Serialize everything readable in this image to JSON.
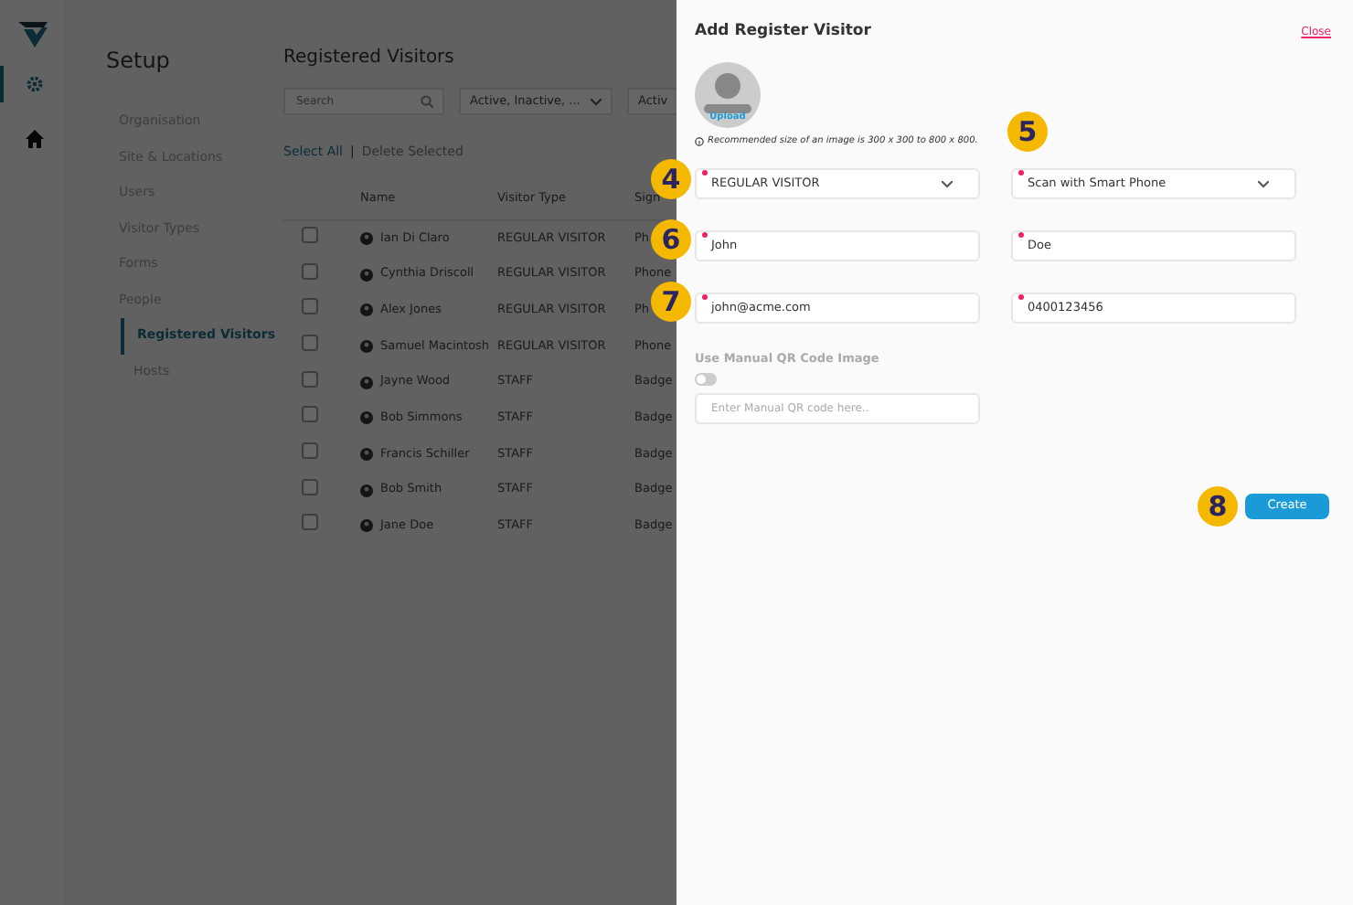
{
  "rail": {
    "items": [
      {
        "kind": "gear",
        "selected": true
      },
      {
        "kind": "home",
        "selected": false
      }
    ]
  },
  "setup": {
    "title": "Setup",
    "nav": [
      {
        "label": "Organisation",
        "selected": false
      },
      {
        "label": "Site & Locations",
        "selected": false
      },
      {
        "label": "Users",
        "selected": false
      },
      {
        "label": "Visitor Types",
        "selected": false
      },
      {
        "label": "Forms",
        "selected": false
      },
      {
        "label": "People",
        "selected": false,
        "children": [
          {
            "label": "Registered Visitors",
            "selected": true
          },
          {
            "label": "Hosts",
            "selected": false
          }
        ]
      }
    ]
  },
  "list": {
    "title": "Registered Visitors",
    "search": {
      "placeholder": "Search"
    },
    "filters": [
      "Active, Inactive, ...",
      "Activ"
    ],
    "select_all": "Select All",
    "separator": "|",
    "delete_selected": "Delete Selected",
    "columns": [
      "Name",
      "Visitor Type",
      "Sign"
    ],
    "rows": [
      {
        "name": "Ian Di Claro",
        "type": "REGULAR VISITOR",
        "column_3": "Ph",
        "checked": false
      },
      {
        "name": "Cynthia Driscoll",
        "type": "REGULAR VISITOR",
        "column_3": "Phone",
        "checked": false
      },
      {
        "name": "Alex Jones",
        "type": "REGULAR VISITOR",
        "column_3": "Ph",
        "checked": false
      },
      {
        "name": "Samuel Macintosh",
        "type": "REGULAR VISITOR",
        "column_3": "Phone",
        "checked": false
      },
      {
        "name": "Jayne Wood",
        "type": "STAFF",
        "column_3": "Badge",
        "checked": false
      },
      {
        "name": "Bob Simmons",
        "type": "STAFF",
        "column_3": "Badge",
        "checked": false
      },
      {
        "name": "Francis Schiller",
        "type": "STAFF",
        "column_3": "Badge",
        "checked": false
      },
      {
        "name": "Bob Smith",
        "type": "STAFF",
        "column_3": "Badge",
        "checked": false
      },
      {
        "name": "Jane Doe",
        "type": "STAFF",
        "column_3": "Badge",
        "checked": false
      }
    ]
  },
  "panel": {
    "title": "Add Register Visitor",
    "close": "Close",
    "avatar_label": "Upload",
    "image_note": "Recommended size of an image is 300 x 300 to 800 x 800.",
    "fields": [
      {
        "kind": "select",
        "value": "REGULAR VISITOR",
        "required": true
      },
      {
        "kind": "select",
        "value": "Scan with Smart Phone",
        "required": true
      },
      {
        "kind": "text",
        "value": "John",
        "required": true
      },
      {
        "kind": "text",
        "value": "Doe",
        "required": true
      },
      {
        "kind": "text",
        "value": "john@acme.com",
        "required": true
      },
      {
        "kind": "text",
        "value": "0400123456",
        "required": true
      }
    ],
    "qr": {
      "label": "Use Manual QR Code Image",
      "on": false,
      "placeholder": "Enter Manual QR code here.."
    },
    "create": "Create"
  },
  "callouts": [
    {
      "number": "4"
    },
    {
      "number": "5"
    },
    {
      "number": "6"
    },
    {
      "number": "7"
    },
    {
      "number": "8"
    }
  ]
}
